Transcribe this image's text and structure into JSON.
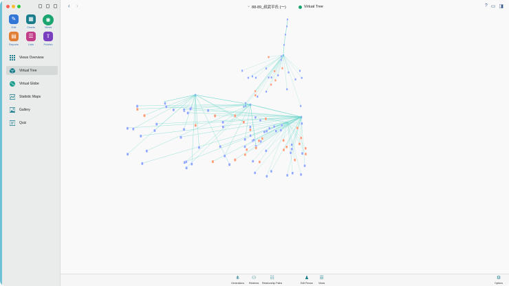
{
  "window": {
    "title": "88-89_叔武平氏 (一)",
    "view_title": "Virtual Tree"
  },
  "toolbar": {
    "back_label": "‹",
    "forward_label": "›",
    "help_label": "?"
  },
  "tools": [
    {
      "label": "Edit",
      "icon": "pencil-icon",
      "glyph": "✎",
      "color": "#3277d6"
    },
    {
      "label": "Charts",
      "icon": "charts-icon",
      "glyph": "▦",
      "color": "#1b7d8c"
    },
    {
      "label": "Views",
      "icon": "eye-icon",
      "glyph": "◉",
      "color": "#1aa470"
    },
    {
      "label": "Reports",
      "icon": "reports-icon",
      "glyph": "▤",
      "color": "#e07e35"
    },
    {
      "label": "Lists",
      "icon": "lists-icon",
      "glyph": "☰",
      "color": "#c23e8a"
    },
    {
      "label": "Publish",
      "icon": "publish-icon",
      "glyph": "⇪",
      "color": "#7a3fbf"
    }
  ],
  "nav": [
    {
      "label": "Views Overview",
      "icon": "grid-icon",
      "active": false
    },
    {
      "label": "Virtual Tree",
      "icon": "cube-icon",
      "active": true
    },
    {
      "label": "Virtual Globe",
      "icon": "globe-icon",
      "active": false
    },
    {
      "label": "Statistic Maps",
      "icon": "map-icon",
      "active": false
    },
    {
      "label": "Gallery",
      "icon": "gallery-icon",
      "active": false
    },
    {
      "label": "Quiz",
      "icon": "quiz-icon",
      "active": false
    }
  ],
  "bottom": {
    "generations": "Generations",
    "relatives": "Relatives",
    "relationship_paths": "Relationship Paths",
    "edit_person": "Edit Person",
    "views": "Views",
    "options": "Options"
  },
  "colors": {
    "accent": "#1aa470",
    "link": "#63d4c8",
    "male": "#8fa6ff",
    "female": "#ff9a76"
  }
}
